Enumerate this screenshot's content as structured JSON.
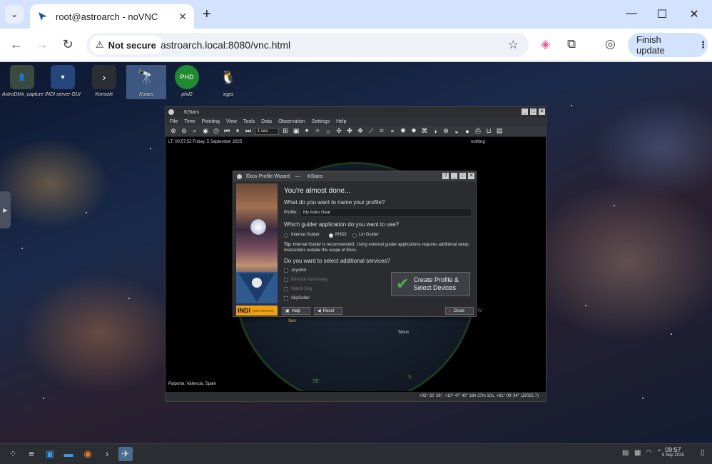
{
  "browser": {
    "tab_title": "root@astroarch - noVNC",
    "security_label": "Not secure",
    "url": "astroarch.local:8080/vnc.html",
    "update_label": "Finish update",
    "new_tab": "+",
    "minimize": "—",
    "maximize": "☐",
    "close": "✕"
  },
  "desktop": {
    "icons": [
      {
        "label": "AstroDMx_capture"
      },
      {
        "label": "INDI server GUI"
      },
      {
        "label": "Konsole"
      },
      {
        "label": "Kstars"
      },
      {
        "label": "phd2"
      },
      {
        "label": "xgps"
      }
    ]
  },
  "kstars": {
    "title": "KStars",
    "menu": [
      "File",
      "Time",
      "Pointing",
      "View",
      "Tools",
      "Data",
      "Observation",
      "Settings",
      "Help"
    ],
    "time_step": "1 sec",
    "lt_info": "LT: 00:57:52    Friday, 5 September 2025",
    "focus_info": "nothing",
    "location": "Paiporta, Valencia, Spain",
    "status_coords": "+03° 32' 36\", +10° 47' 40\"   18h 27m 10s, +61° 09' 34\" (J2025.7)",
    "sky_labels": {
      "sun": "Sun",
      "sirius": "Sirius",
      "se": "SE",
      "s": "S",
      "w": "W"
    }
  },
  "wizard": {
    "title": "Ekos Profile Wizard",
    "app": "KStars",
    "heading": "You're almost done...",
    "q_name": "What do you want to name your profile?",
    "profile_label": "Profile:",
    "profile_value": "My Astro Gear",
    "q_guider": "Which guider application do you want to use?",
    "guiders": [
      "Internal Guider",
      "PHD2",
      "Lin Guider"
    ],
    "tip_label": "Tip:",
    "tip_text": "Internal Guider is recommended. Using external guider applications requires additional setup instructions outside the scope of Ekos.",
    "q_services": "Do you want to select additional services?",
    "services": [
      "Joystick",
      "Remote Astrometry",
      "Watch Dog",
      "SkySafari"
    ],
    "create_line1": "Create Profile &",
    "create_line2": "Select Devices",
    "help": "Help",
    "reset": "Reset",
    "close": "Close",
    "indi_logo": "INDI",
    "indi_sub": "Open Astronomy Instrumentation"
  },
  "taskbar": {
    "clock_time": "09:57",
    "clock_date": "5 Sep 2025"
  }
}
